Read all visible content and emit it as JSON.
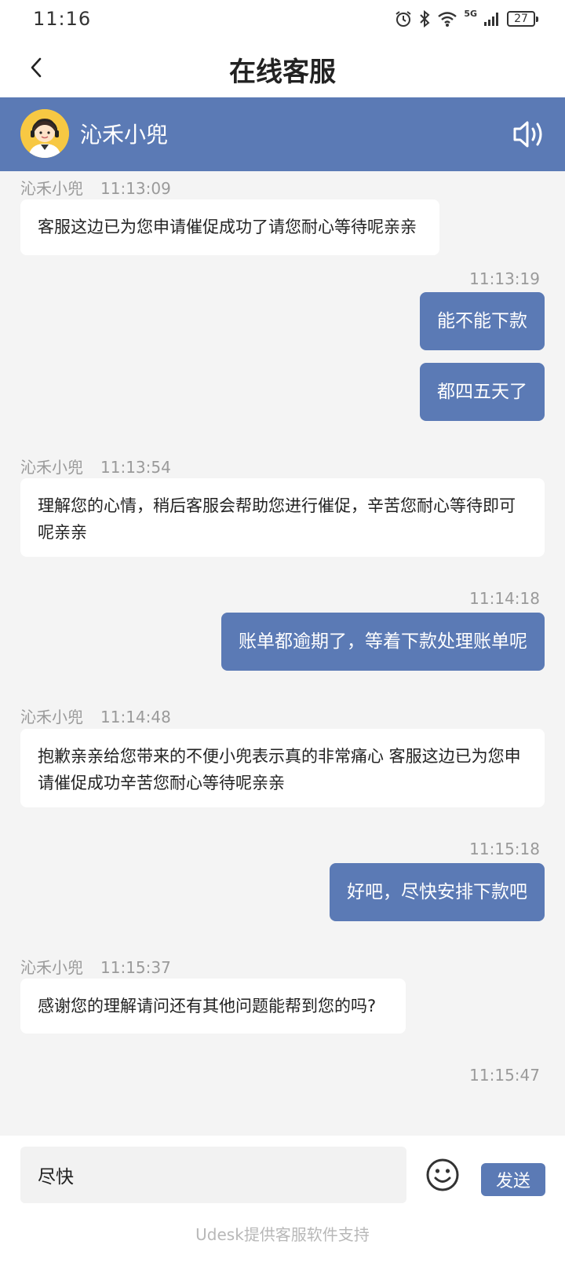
{
  "status_bar": {
    "time": "11:16",
    "network": "5G",
    "battery": "27"
  },
  "nav": {
    "title": "在线客服"
  },
  "agent": {
    "name": "沁禾小兜"
  },
  "messages": [
    {
      "from": "agent",
      "name": "沁禾小兜",
      "time": "11:13:09",
      "text": "客服这边已为您申请催促成功了请您耐心等待呢亲亲"
    },
    {
      "from": "user",
      "time": "11:13:19",
      "text": "能不能下款"
    },
    {
      "from": "user",
      "text": "都四五天了"
    },
    {
      "from": "agent",
      "name": "沁禾小兜",
      "time": "11:13:54",
      "text": "理解您的心情，稍后客服会帮助您进行催促，辛苦您耐心等待即可呢亲亲"
    },
    {
      "from": "user",
      "time": "11:14:18",
      "text": "账单都逾期了，等着下款处理账单呢"
    },
    {
      "from": "agent",
      "name": "沁禾小兜",
      "time": "11:14:48",
      "text": "抱歉亲亲给您带来的不便小兜表示真的非常痛心 客服这边已为您申请催促成功辛苦您耐心等待呢亲亲"
    },
    {
      "from": "user",
      "time": "11:15:18",
      "text": "好吧，尽快安排下款吧"
    },
    {
      "from": "agent",
      "name": "沁禾小兜",
      "time": "11:15:37",
      "text": "感谢您的理解请问还有其他问题能帮到您的吗?"
    },
    {
      "from": "user",
      "time": "11:15:47"
    }
  ],
  "input": {
    "value": "尽快"
  },
  "actions": {
    "send_label": "发送"
  },
  "footer": {
    "note": "Udesk提供客服软件支持"
  },
  "colors": {
    "accent": "#5b7ab5",
    "background": "#f4f4f4",
    "agent_bubble": "#ffffff"
  }
}
